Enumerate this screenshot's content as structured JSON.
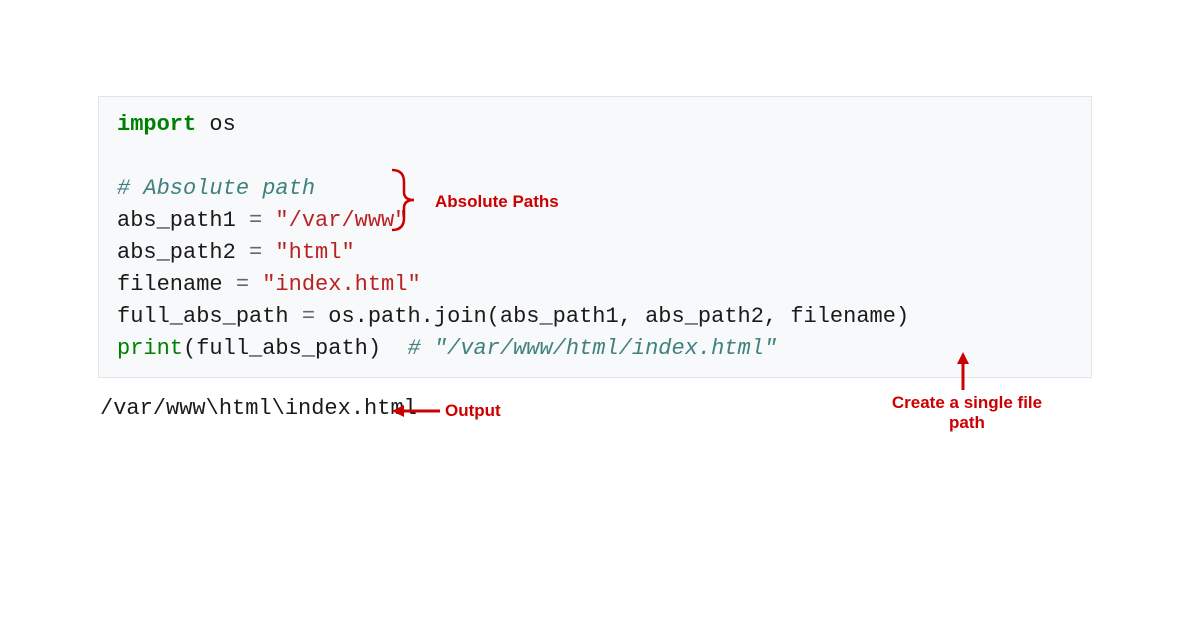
{
  "code": {
    "import_kw": "import",
    "import_mod": " os",
    "comment1": "# Absolute path",
    "l3_var": "abs_path1 ",
    "l3_op": "=",
    "l3_str": " \"/var/www\"",
    "l4_var": "abs_path2 ",
    "l4_op": "=",
    "l4_str": " \"html\"",
    "l5_var": "filename ",
    "l5_op": "=",
    "l5_str": " \"index.html\"",
    "l6_var": "full_abs_path ",
    "l6_op": "=",
    "l6_rest": " os.path.join(abs_path1, abs_path2, filename)",
    "l7_fn": "print",
    "l7_args": "(full_abs_path)  ",
    "l7_cmt": "# \"/var/www/html/index.html\""
  },
  "output": "/var/www\\html\\index.html",
  "annotations": {
    "abs_paths": "Absolute Paths",
    "output": "Output",
    "single_path": "Create a single file path"
  }
}
